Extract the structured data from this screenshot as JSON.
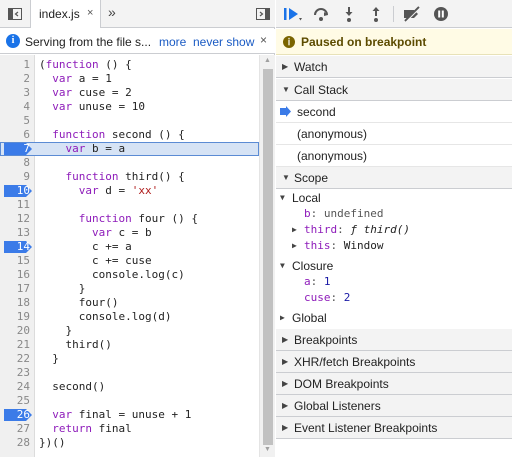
{
  "left_tabbar": {
    "tab_label": "index.js",
    "tab_close": "×",
    "more_tabs": "»"
  },
  "infobar": {
    "message": "Serving from the file s...",
    "more_link": "more",
    "never_show_link": "never show",
    "close": "×"
  },
  "editor": {
    "lines": [
      {
        "n": "1",
        "text": "(function () {"
      },
      {
        "n": "2",
        "text": "  var a = 1"
      },
      {
        "n": "3",
        "text": "  var cuse = 2"
      },
      {
        "n": "4",
        "text": "  var unuse = 10"
      },
      {
        "n": "5",
        "text": ""
      },
      {
        "n": "6",
        "text": "  function second () {"
      },
      {
        "n": "7",
        "text": "    var b = a"
      },
      {
        "n": "8",
        "text": ""
      },
      {
        "n": "9",
        "text": "    function third() {"
      },
      {
        "n": "10",
        "text": "      var d = 'xx'"
      },
      {
        "n": "11",
        "text": ""
      },
      {
        "n": "12",
        "text": "      function four () {"
      },
      {
        "n": "13",
        "text": "        var c = b"
      },
      {
        "n": "14",
        "text": "        c += a"
      },
      {
        "n": "15",
        "text": "        c += cuse"
      },
      {
        "n": "16",
        "text": "        console.log(c)"
      },
      {
        "n": "17",
        "text": "      }"
      },
      {
        "n": "18",
        "text": "      four()"
      },
      {
        "n": "19",
        "text": "      console.log(d)"
      },
      {
        "n": "20",
        "text": "    }"
      },
      {
        "n": "21",
        "text": "    third()"
      },
      {
        "n": "22",
        "text": "  }"
      },
      {
        "n": "23",
        "text": ""
      },
      {
        "n": "24",
        "text": "  second()"
      },
      {
        "n": "25",
        "text": ""
      },
      {
        "n": "26",
        "text": "  var final = unuse + 1"
      },
      {
        "n": "27",
        "text": "  return final"
      },
      {
        "n": "28",
        "text": "})()"
      }
    ],
    "breakpoint_lines": [
      "7",
      "10",
      "14",
      "26"
    ],
    "current_line": "7"
  },
  "debugger": {
    "paused_label": "Paused on breakpoint",
    "sections": {
      "watch": "Watch",
      "call_stack": "Call Stack",
      "scope": "Scope",
      "breakpoints": "Breakpoints",
      "xhr": "XHR/fetch Breakpoints",
      "dom": "DOM Breakpoints",
      "global_listeners": "Global Listeners",
      "event_listener": "Event Listener Breakpoints"
    },
    "call_stack": [
      "second",
      "(anonymous)",
      "(anonymous)"
    ],
    "scope": {
      "local_label": "Local",
      "local_b_name": "b",
      "local_b_value": "undefined",
      "local_third_name": "third",
      "local_third_value": "ƒ third()",
      "local_this_name": "this",
      "local_this_value": "Window",
      "closure_label": "Closure",
      "closure_a_name": "a",
      "closure_a_value": "1",
      "closure_cuse_name": "cuse",
      "closure_cuse_value": "2",
      "global_label": "Global"
    }
  },
  "colors": {
    "breakpoint": "#3b7be8",
    "exec_line": "#d6e3f5",
    "paused_bg": "#fffbe5",
    "accent": "#1a73e8"
  }
}
